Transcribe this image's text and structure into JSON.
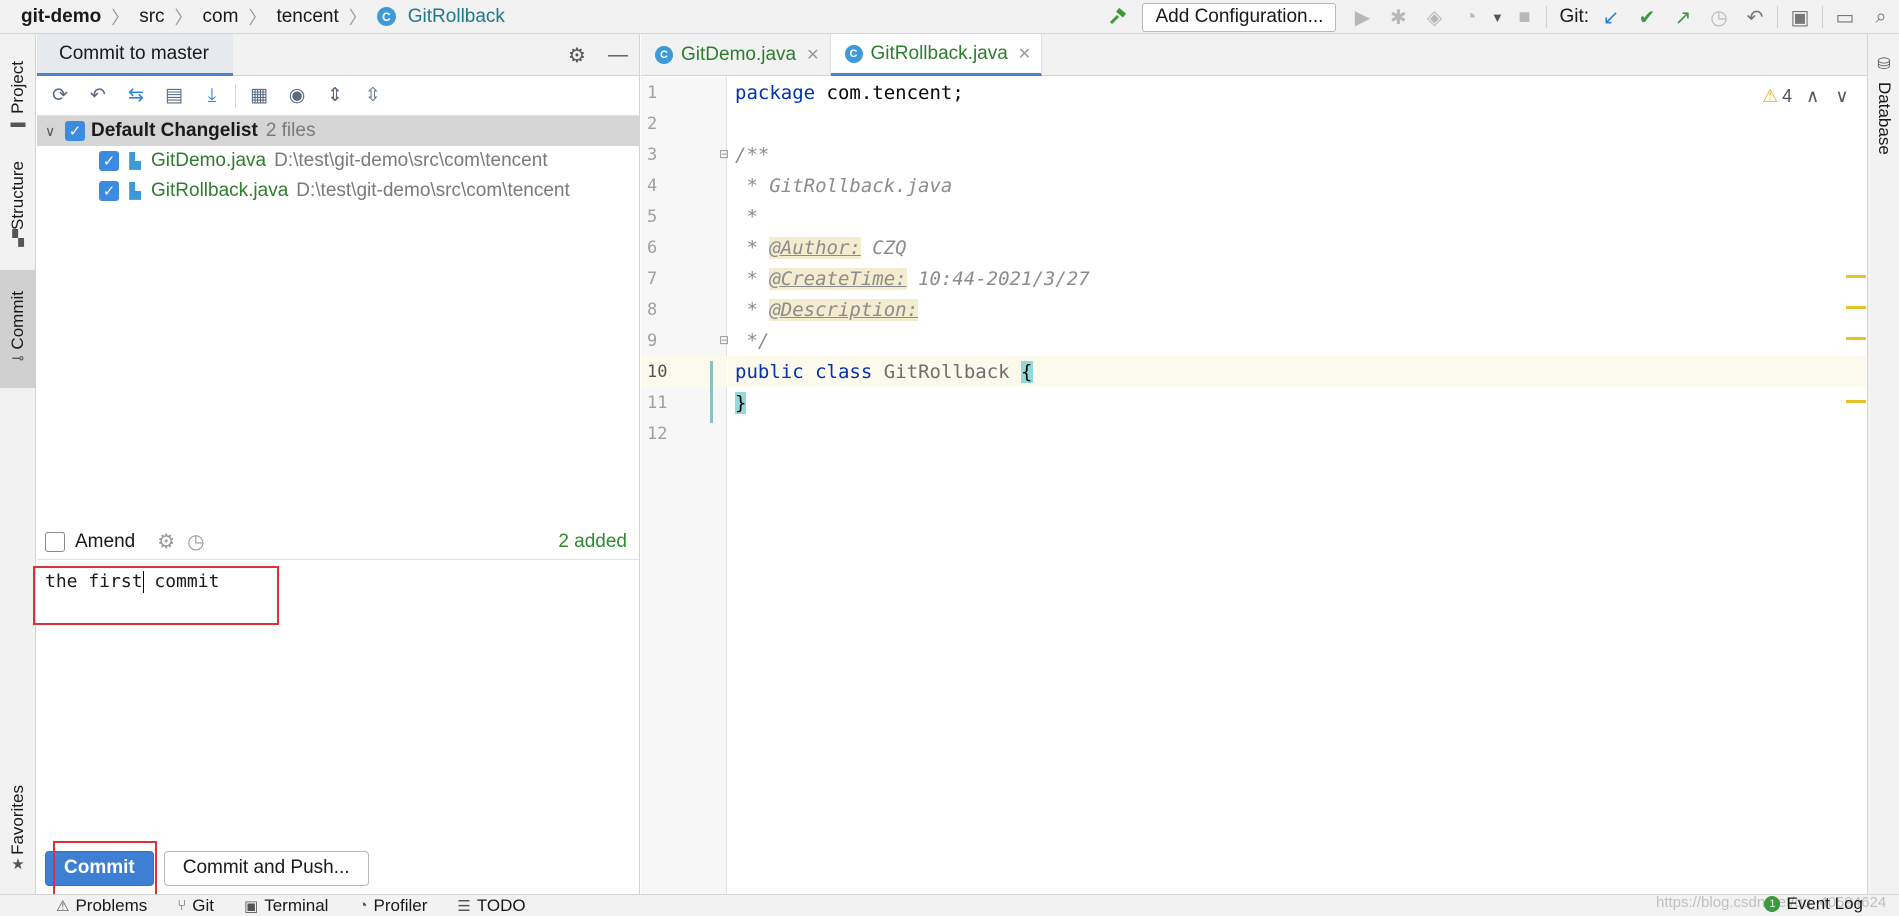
{
  "breadcrumb": {
    "project": "git-demo",
    "segments": [
      "src",
      "com",
      "tencent"
    ],
    "class_badge": "C",
    "class_name": "GitRollback"
  },
  "navbar": {
    "config_label": "Add Configuration...",
    "git_label": "Git:"
  },
  "left_strip": {
    "tabs": [
      "Project",
      "Structure",
      "Commit",
      "Favorites"
    ]
  },
  "commit_panel": {
    "title": "Commit to master",
    "changelist": {
      "name": "Default Changelist",
      "count": "2 files",
      "files": [
        {
          "name": "GitDemo.java",
          "path": "D:\\test\\git-demo\\src\\com\\tencent"
        },
        {
          "name": "GitRollback.java",
          "path": "D:\\test\\git-demo\\src\\com\\tencent"
        }
      ]
    },
    "amend_label": "Amend",
    "added_label": "2 added",
    "message": {
      "before_caret": "the first",
      "after_caret": " commit"
    },
    "commit_button": "Commit",
    "commit_push_button": "Commit and Push..."
  },
  "editor": {
    "tabs": [
      {
        "label": "GitDemo.java",
        "badge": "C"
      },
      {
        "label": "GitRollback.java",
        "badge": "C"
      }
    ],
    "line_numbers": [
      "1",
      "2",
      "3",
      "4",
      "5",
      "6",
      "7",
      "8",
      "9",
      "10",
      "11",
      "12"
    ],
    "code": {
      "l1_kw": "package",
      "l1_rest": " com.tencent;",
      "l3": "/**",
      "l4": " * GitRollback.java",
      "l5": " *",
      "l6_star": " * ",
      "l6_tag": "@Author:",
      "l6_val": " CZQ",
      "l7_star": " * ",
      "l7_tag": "@CreateTime:",
      "l7_val": " 10:44-2021/3/27",
      "l8_star": " * ",
      "l8_tag": "@Description:",
      "l9": " */",
      "l10_kw1": "public",
      "l10_kw2": "class",
      "l10_cls": "GitRollback",
      "l10_brace": "{",
      "l11_brace": "}"
    },
    "warnings_count": "4"
  },
  "right_strip": {
    "tab": "Database"
  },
  "bottom_bar": {
    "items": [
      "Problems",
      "Git",
      "Terminal",
      "Profiler",
      "TODO"
    ],
    "watermark": "https://blog.csdn.net/qq_40594624",
    "event_log": "Event Log",
    "event_count": "1"
  },
  "colors": {
    "accent": "#3d7fd2",
    "annotation_red": "#e0303a",
    "added_green": "#2d8a2d",
    "keyword_blue": "#0033b3"
  },
  "icons": [
    "hammer-icon",
    "run-icon",
    "debug-icon",
    "coverage-icon",
    "profile-icon",
    "stop-icon",
    "git-update-icon",
    "git-commit-icon",
    "git-push-icon",
    "history-icon",
    "rollback-icon",
    "project-structure-icon",
    "presentation-icon",
    "gear-icon",
    "minimize-icon",
    "refresh-icon",
    "undo-icon",
    "diff-icon",
    "shelve-icon",
    "download-icon",
    "group-icon",
    "eye-icon",
    "expand-icon",
    "collapse-icon",
    "clock-icon",
    "warning-icon",
    "database-icon",
    "star-icon"
  ]
}
